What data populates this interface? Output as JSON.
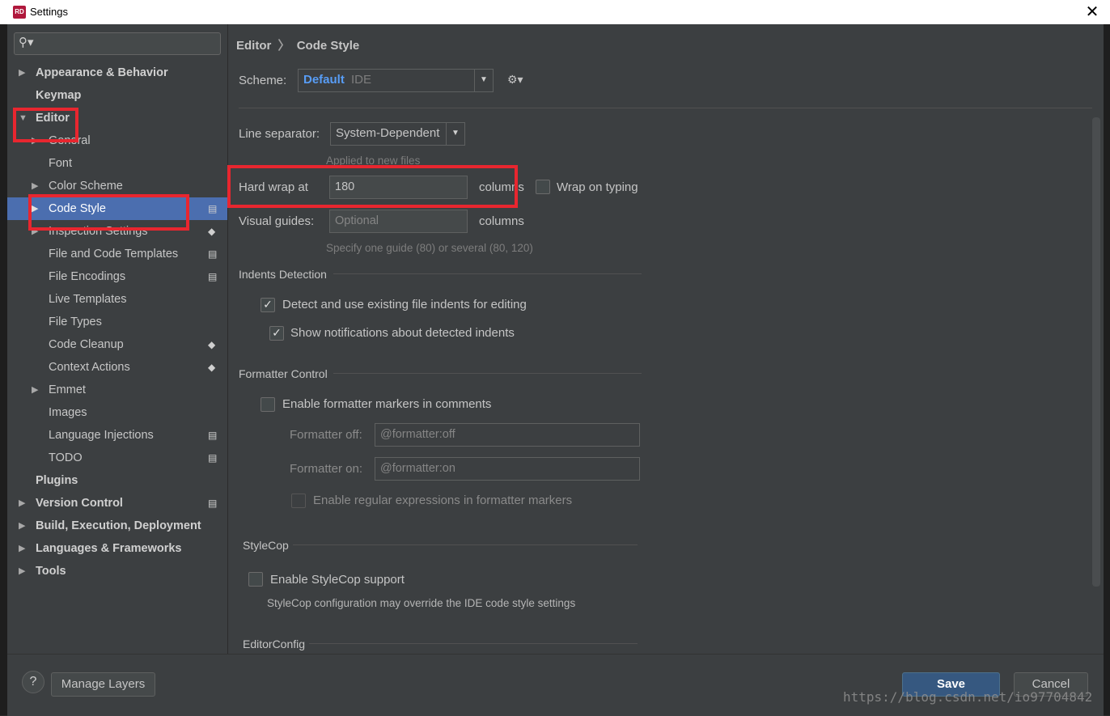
{
  "window": {
    "title": "Settings",
    "app_icon_text": "RD",
    "close_glyph": "✕"
  },
  "search": {
    "placeholder": "",
    "icon": "search-icon"
  },
  "sidebar": {
    "items": [
      {
        "label": "Appearance & Behavior",
        "expandable": true
      },
      {
        "label": "Keymap"
      },
      {
        "label": "Editor",
        "expanded": true
      },
      {
        "label": "General",
        "expandable": true
      },
      {
        "label": "Font"
      },
      {
        "label": "Color Scheme",
        "expandable": true
      },
      {
        "label": "Code Style",
        "selected": true
      },
      {
        "label": "Inspection Settings"
      },
      {
        "label": "File and Code Templates"
      },
      {
        "label": "File Encodings"
      },
      {
        "label": "Live Templates"
      },
      {
        "label": "File Types"
      },
      {
        "label": "Code Cleanup"
      },
      {
        "label": "Context Actions"
      },
      {
        "label": "Emmet"
      },
      {
        "label": "Images"
      },
      {
        "label": "Language Injections"
      },
      {
        "label": "TODO"
      },
      {
        "label": "Plugins"
      },
      {
        "label": "Version Control"
      },
      {
        "label": "Build, Execution, Deployment"
      },
      {
        "label": "Languages & Frameworks"
      },
      {
        "label": "Tools"
      }
    ]
  },
  "breadcrumb": {
    "parent": "Editor",
    "separator": "〉",
    "current": "Code Style"
  },
  "scheme": {
    "label": "Scheme:",
    "name": "Default",
    "suffix": "IDE"
  },
  "line_separator": {
    "label": "Line separator:",
    "value": "System-Dependent",
    "hint": "Applied to new files"
  },
  "hard_wrap": {
    "label": "Hard wrap at",
    "value": "180",
    "unit": "columns",
    "wrap_on_typing": "Wrap on typing"
  },
  "visual_guides": {
    "label": "Visual guides:",
    "placeholder": "Optional",
    "unit": "columns",
    "hint": "Specify one guide (80) or several (80, 120)"
  },
  "indents": {
    "title": "Indents Detection",
    "detect": "Detect and use existing file indents for editing",
    "notify": "Show notifications about detected indents"
  },
  "formatter": {
    "title": "Formatter Control",
    "enable": "Enable formatter markers in comments",
    "off_label": "Formatter off:",
    "off_value": "@formatter:off",
    "on_label": "Formatter on:",
    "on_value": "@formatter:on",
    "regex": "Enable regular expressions in formatter markers"
  },
  "stylecop": {
    "title": "StyleCop",
    "enable": "Enable StyleCop support",
    "note": "StyleCop configuration may override the IDE code style settings"
  },
  "editorconfig": {
    "title": "EditorConfig"
  },
  "footer": {
    "help": "?",
    "manage_layers": "Manage Layers",
    "save": "Save",
    "cancel": "Cancel"
  },
  "watermark": "https://blog.csdn.net/io97704842",
  "colors": {
    "selection": "#4b6eaf",
    "accent_text": "#589df6",
    "highlight_box": "#e8262f",
    "primary_button": "#365880"
  }
}
